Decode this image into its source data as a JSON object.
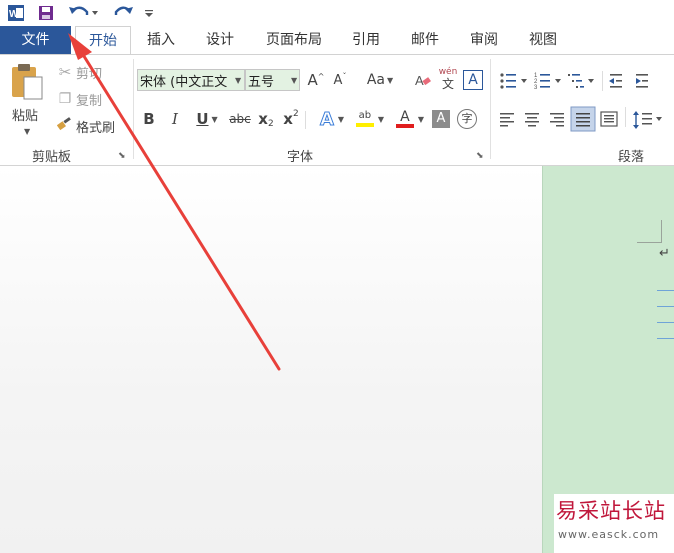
{
  "tabs": {
    "file": "文件",
    "home": "开始",
    "insert": "插入",
    "design": "设计",
    "layout": "页面布局",
    "references": "引用",
    "mailings": "邮件",
    "review": "审阅",
    "view": "视图"
  },
  "clipboard": {
    "paste": "粘贴",
    "cut": "剪切",
    "copy": "复制",
    "format_painter": "格式刷",
    "group_label": "剪贴板"
  },
  "font": {
    "name": "宋体 (中文正文",
    "size": "五号",
    "grow": "A",
    "shrink": "A",
    "change_case": "Aa",
    "bold": "B",
    "italic": "I",
    "underline": "U",
    "strike": "abc",
    "subscript": "x",
    "superscript": "x",
    "sub_mark": "2",
    "sup_mark": "2",
    "effects": "A",
    "highlight": "ab",
    "color": "A",
    "shading": "A",
    "enclose": "字",
    "phonetic": "wén",
    "phonetic_char": "文",
    "border": "A",
    "group_label": "字体"
  },
  "paragraph": {
    "group_label": "段落"
  },
  "watermark": {
    "text": "易采站长站",
    "url": "www.easck.com"
  },
  "colors": {
    "file_tab": "#2b579a",
    "doc_bg": "#cce8cf",
    "arrow": "#e8403a",
    "watermark": "#c0173b"
  }
}
